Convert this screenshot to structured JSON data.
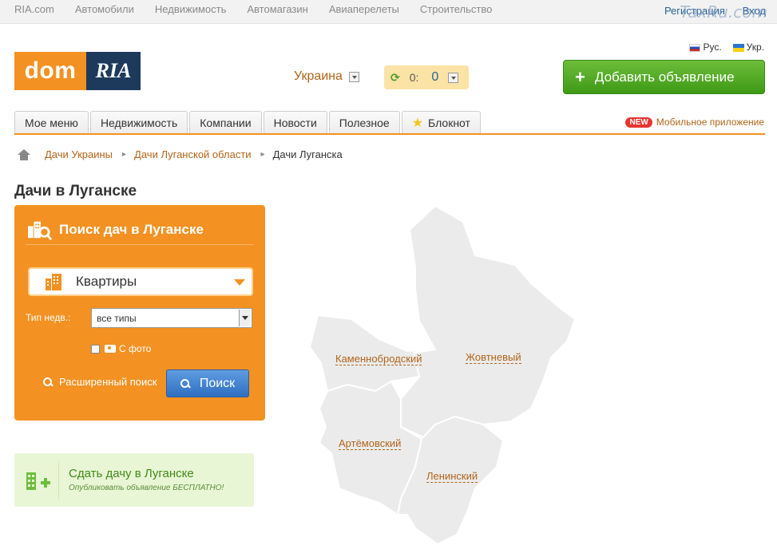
{
  "topbar": {
    "links": [
      "RIA.com",
      "Автомобили",
      "Недвижимость",
      "Автомагазин",
      "Авиаперелеты",
      "Строительство"
    ],
    "register": "Регистрация",
    "login": "Вход",
    "watermark": "TaxRu.com"
  },
  "header": {
    "logo_dom": "dom",
    "logo_ria": "RIA",
    "region": "Украина",
    "counter_a": "0:",
    "counter_b": "0",
    "lang_ru": "Рус.",
    "lang_ua": "Укр.",
    "add_button": "Добавить объявление",
    "add_plus": "+"
  },
  "tabs": [
    "Мое меню",
    "Недвижимость",
    "Компании",
    "Новости",
    "Полезное",
    "Блокнот"
  ],
  "mobile": {
    "badge": "NEW",
    "label": "Мобильное приложение"
  },
  "breadcrumb": [
    "Дачи Украины",
    "Дачи Луганской области",
    "Дачи Луганска"
  ],
  "page_title": "Дачи в Луганске",
  "search": {
    "title": "Поиск дач в Луганске",
    "category": "Квартиры",
    "type_label": "Тип недв.:",
    "type_value": "все типы",
    "photo_label": "С фото",
    "advanced": "Расширенный поиск",
    "button": "Поиск"
  },
  "post": {
    "title": "Сдать дачу в Луганске",
    "subtitle": "Опубликовать объявление БЕСПЛАТНО!"
  },
  "map": {
    "districts": [
      "Каменнобродский",
      "Жовтневый",
      "Артёмовский",
      "Ленинский"
    ],
    "fill_color": "#ebebeb"
  },
  "colors": {
    "accent": "#f39122",
    "link": "#b0651a",
    "green": "#4a9d2c"
  }
}
